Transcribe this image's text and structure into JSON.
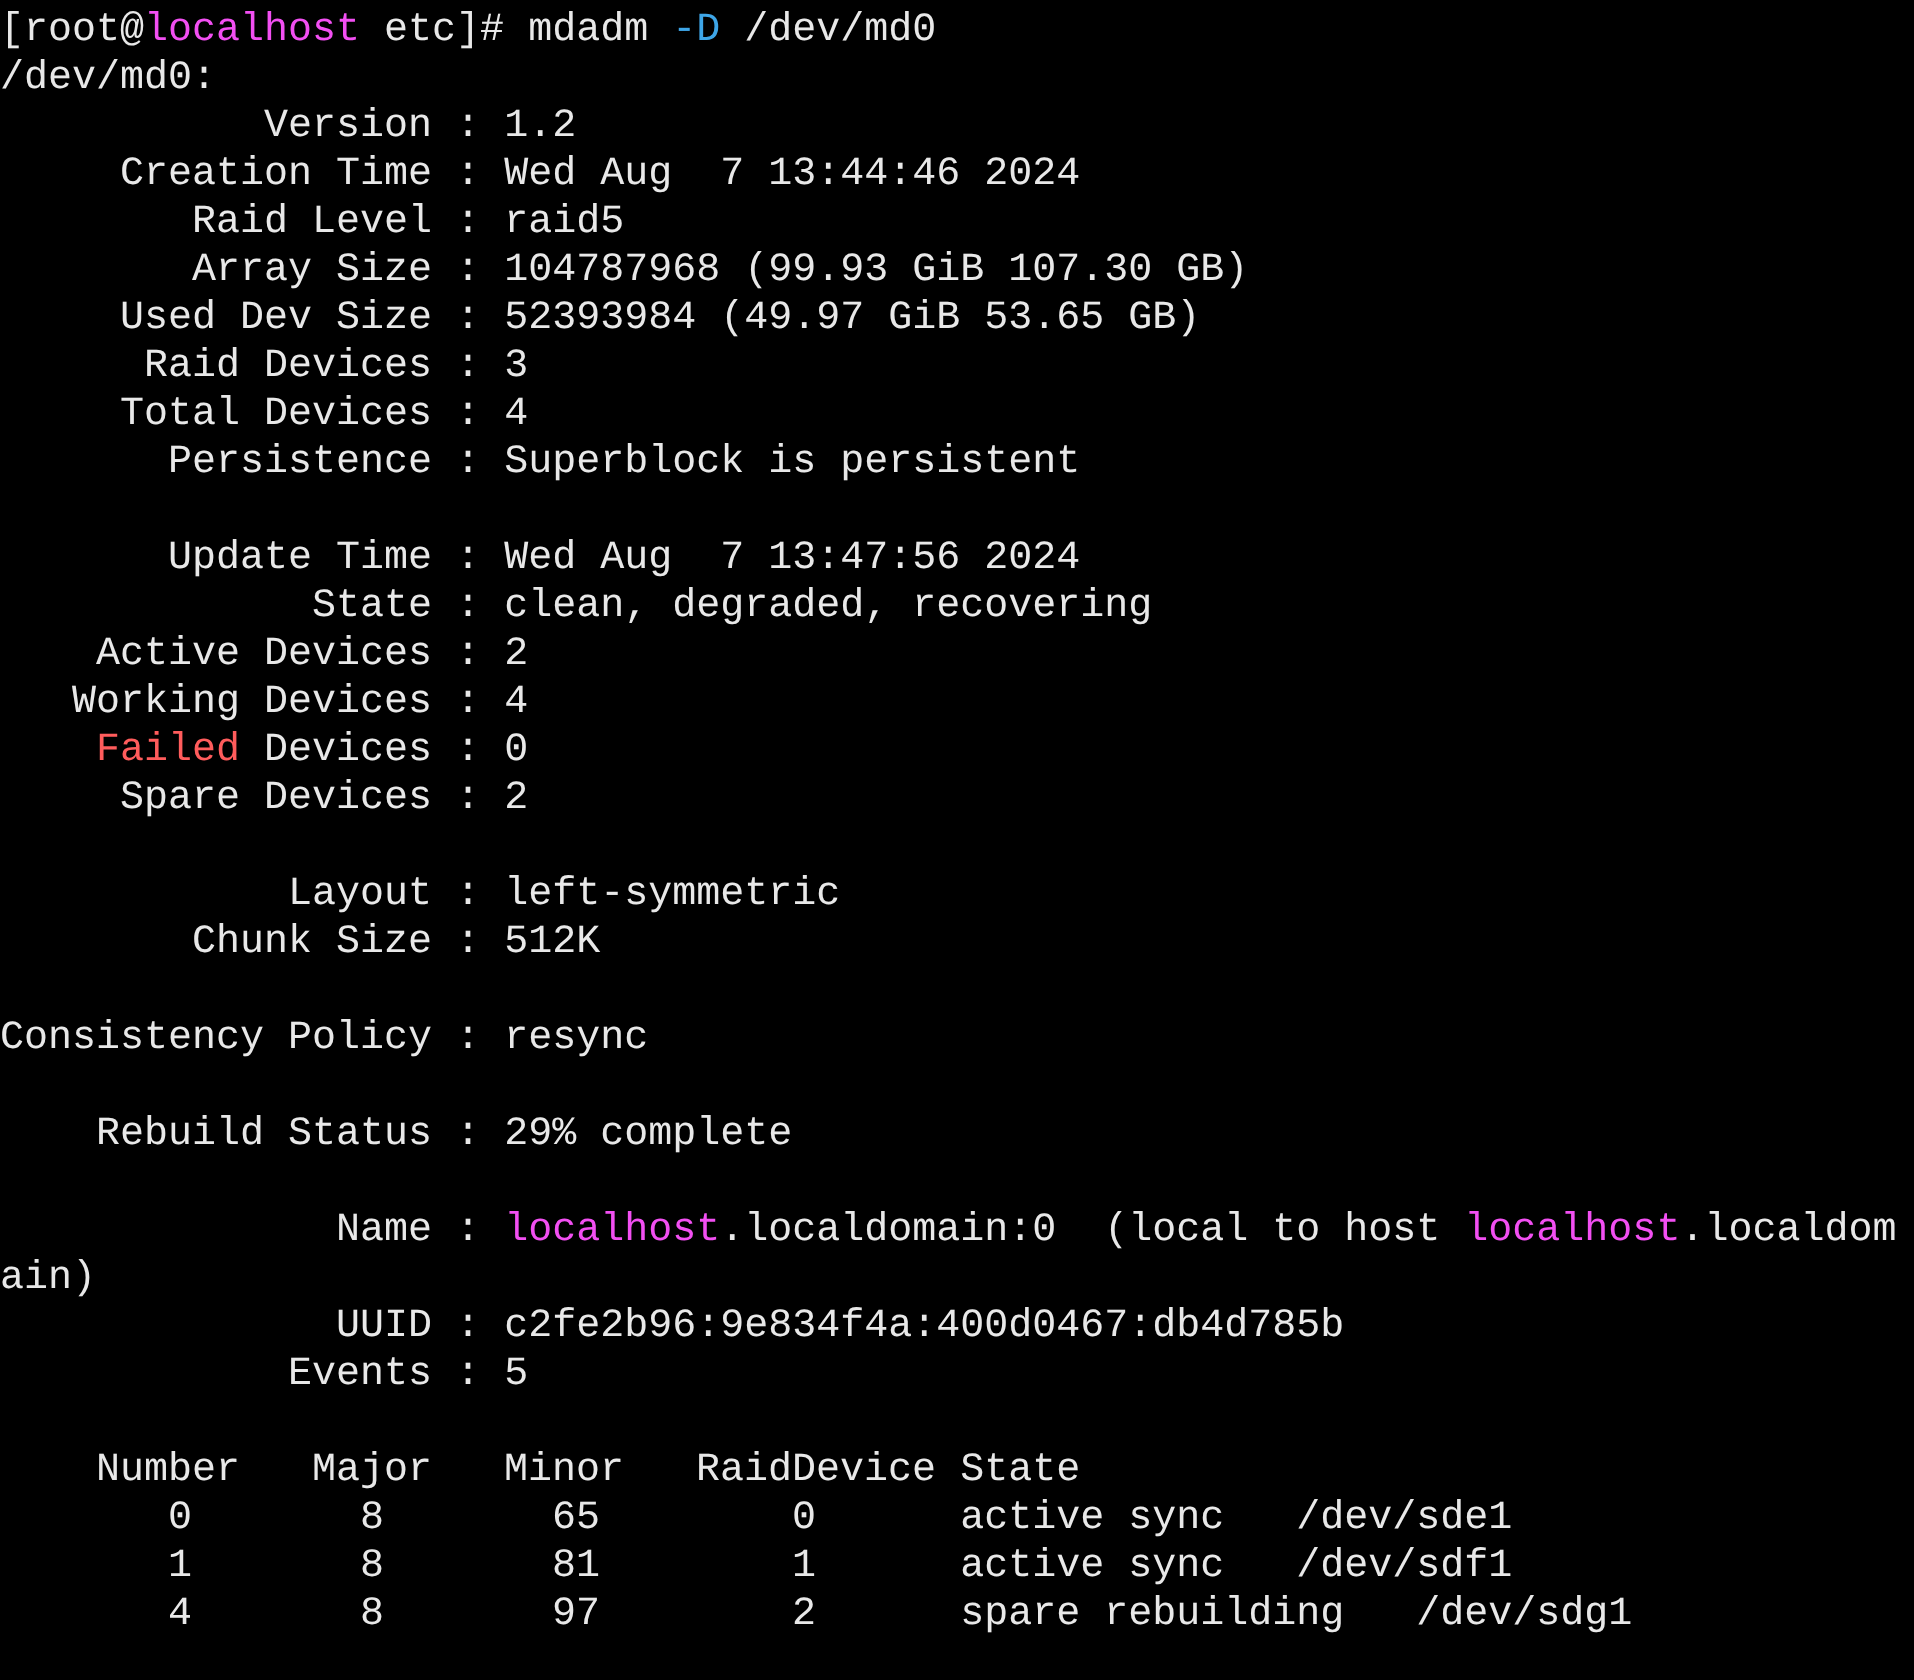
{
  "prompt": [
    {
      "text": "[root@",
      "kind": "plain"
    },
    {
      "text": "localhost",
      "kind": "host"
    },
    {
      "text": " etc]# ",
      "kind": "plain"
    }
  ],
  "command": [
    {
      "text": "mdadm ",
      "kind": "plain"
    },
    {
      "text": "-D",
      "kind": "option"
    },
    {
      "text": " /dev/md0",
      "kind": "plain"
    }
  ],
  "device_header": "/dev/md0:",
  "groups": [
    [
      {
        "label": [
          {
            "text": "Version",
            "kind": "plain"
          }
        ],
        "colon": ":",
        "value": [
          {
            "text": "1.2",
            "kind": "plain"
          }
        ]
      },
      {
        "label": [
          {
            "text": "Creation Time",
            "kind": "plain"
          }
        ],
        "colon": ":",
        "value": [
          {
            "text": "Wed Aug  7 13:44:46 2024",
            "kind": "plain"
          }
        ]
      },
      {
        "label": [
          {
            "text": "Raid Level",
            "kind": "plain"
          }
        ],
        "colon": ":",
        "value": [
          {
            "text": "raid5",
            "kind": "plain"
          }
        ]
      },
      {
        "label": [
          {
            "text": "Array Size",
            "kind": "plain"
          }
        ],
        "colon": ":",
        "value": [
          {
            "text": "104787968 (99.93 GiB 107.30 GB)",
            "kind": "plain"
          }
        ]
      },
      {
        "label": [
          {
            "text": "Used Dev Size",
            "kind": "plain"
          }
        ],
        "colon": ":",
        "value": [
          {
            "text": "52393984 (49.97 GiB 53.65 GB)",
            "kind": "plain"
          }
        ]
      },
      {
        "label": [
          {
            "text": "Raid Devices",
            "kind": "plain"
          }
        ],
        "colon": ":",
        "value": [
          {
            "text": "3",
            "kind": "plain"
          }
        ]
      },
      {
        "label": [
          {
            "text": "Total Devices",
            "kind": "plain"
          }
        ],
        "colon": ":",
        "value": [
          {
            "text": "4",
            "kind": "plain"
          }
        ]
      },
      {
        "label": [
          {
            "text": "Persistence",
            "kind": "plain"
          }
        ],
        "colon": ":",
        "value": [
          {
            "text": "Superblock is persistent",
            "kind": "plain"
          }
        ]
      }
    ],
    [
      {
        "label": [
          {
            "text": "Update Time",
            "kind": "plain"
          }
        ],
        "colon": ":",
        "value": [
          {
            "text": "Wed Aug  7 13:47:56 2024",
            "kind": "plain"
          }
        ]
      },
      {
        "label": [
          {
            "text": "State",
            "kind": "plain"
          }
        ],
        "colon": ":",
        "value": [
          {
            "text": "clean, degraded, recovering",
            "kind": "plain"
          }
        ]
      },
      {
        "label": [
          {
            "text": "Active Devices",
            "kind": "plain"
          }
        ],
        "colon": ":",
        "value": [
          {
            "text": "2",
            "kind": "plain"
          }
        ]
      },
      {
        "label": [
          {
            "text": "Working Devices",
            "kind": "plain"
          }
        ],
        "colon": ":",
        "value": [
          {
            "text": "4",
            "kind": "plain"
          }
        ]
      },
      {
        "label": [
          {
            "text": "Failed",
            "kind": "warn"
          },
          {
            "text": " Devices",
            "kind": "plain"
          }
        ],
        "colon": ":",
        "value": [
          {
            "text": "0",
            "kind": "plain"
          }
        ]
      },
      {
        "label": [
          {
            "text": "Spare Devices",
            "kind": "plain"
          }
        ],
        "colon": ":",
        "value": [
          {
            "text": "2",
            "kind": "plain"
          }
        ]
      }
    ],
    [
      {
        "label": [
          {
            "text": "Layout",
            "kind": "plain"
          }
        ],
        "colon": ":",
        "value": [
          {
            "text": "left-symmetric",
            "kind": "plain"
          }
        ]
      },
      {
        "label": [
          {
            "text": "Chunk Size",
            "kind": "plain"
          }
        ],
        "colon": ":",
        "value": [
          {
            "text": "512K",
            "kind": "plain"
          }
        ]
      }
    ],
    [
      {
        "label": [
          {
            "text": "Consistency Policy",
            "kind": "plain"
          }
        ],
        "colon": ":",
        "value": [
          {
            "text": "resync",
            "kind": "plain"
          }
        ]
      }
    ],
    [
      {
        "label": [
          {
            "text": "Rebuild Status",
            "kind": "plain"
          }
        ],
        "colon": ":",
        "value": [
          {
            "text": "29% complete",
            "kind": "plain"
          }
        ]
      }
    ],
    [
      {
        "label": [
          {
            "text": "Name",
            "kind": "plain"
          }
        ],
        "colon": ":",
        "value": [
          {
            "text": "localhost",
            "kind": "host"
          },
          {
            "text": ".localdomain:0  (local to host ",
            "kind": "plain"
          },
          {
            "text": "localhost",
            "kind": "host"
          },
          {
            "text": ".localdom",
            "kind": "plain"
          }
        ],
        "continuation": "ain)"
      },
      {
        "label": [
          {
            "text": "UUID",
            "kind": "plain"
          }
        ],
        "colon": ":",
        "value": [
          {
            "text": "c2fe2b96:9e834f4a:400d0467:db4d785b",
            "kind": "plain"
          }
        ]
      },
      {
        "label": [
          {
            "text": "Events",
            "kind": "plain"
          }
        ],
        "colon": ":",
        "value": [
          {
            "text": "5",
            "kind": "plain"
          }
        ]
      }
    ]
  ],
  "table": {
    "columns": [
      "Number",
      "Major",
      "Minor",
      "RaidDevice",
      "State"
    ],
    "rows": [
      {
        "number": "0",
        "major": "8",
        "minor": "65",
        "raid_device": "0",
        "state": "active sync",
        "device": "/dev/sde1"
      },
      {
        "number": "1",
        "major": "8",
        "minor": "81",
        "raid_device": "1",
        "state": "active sync",
        "device": "/dev/sdf1"
      },
      {
        "number": "4",
        "major": "8",
        "minor": "97",
        "raid_device": "2",
        "state": "spare rebuilding",
        "device": "/dev/sdg1"
      }
    ]
  }
}
